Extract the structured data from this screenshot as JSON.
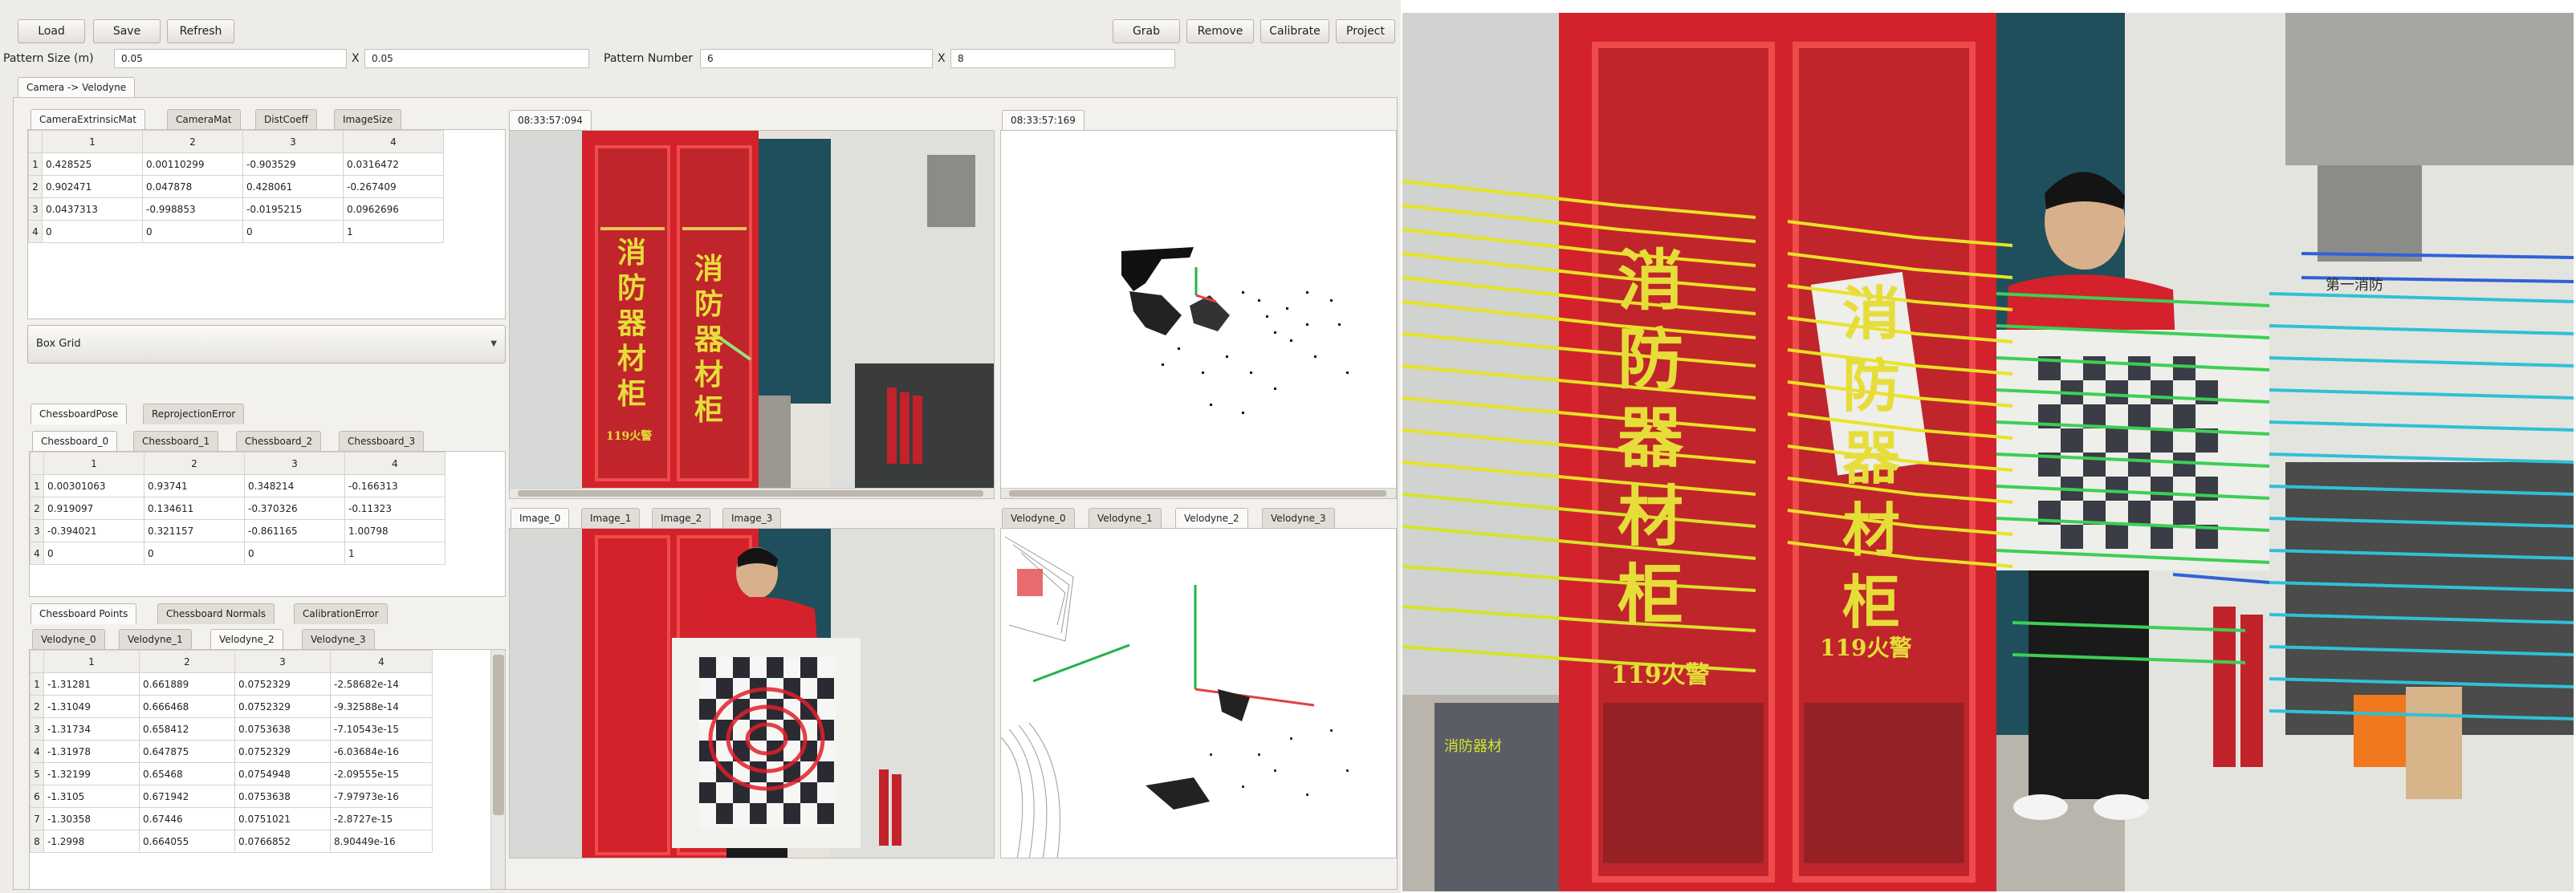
{
  "toolbar": {
    "load": "Load",
    "save": "Save",
    "refresh": "Refresh",
    "grab": "Grab",
    "remove": "Remove",
    "calibrate": "Calibrate",
    "project": "Project"
  },
  "params": {
    "pattern_size_label": "Pattern Size (m)",
    "pattern_size_x": "0.05",
    "x_sep1": "X",
    "pattern_size_y": "0.05",
    "pattern_number_label": "Pattern Number",
    "pattern_number_x": "6",
    "x_sep2": "X",
    "pattern_number_y": "8"
  },
  "main_tab": "Camera -> Velodyne",
  "extrinsic": {
    "tabs": [
      "CameraExtrinsicMat",
      "CameraMat",
      "DistCoeff",
      "ImageSize"
    ],
    "columns": [
      "1",
      "2",
      "3",
      "4"
    ],
    "rows": [
      [
        "1",
        "0.428525",
        "0.00110299",
        "-0.903529",
        "0.0316472"
      ],
      [
        "2",
        "0.902471",
        "0.047878",
        "0.428061",
        "-0.267409"
      ],
      [
        "3",
        "0.0437313",
        "-0.998853",
        "-0.0195215",
        "0.0962696"
      ],
      [
        "4",
        "0",
        "0",
        "0",
        "1"
      ]
    ]
  },
  "pattern_combo": "Box Grid",
  "pose": {
    "tabs": [
      "ChessboardPose",
      "ReprojectionError"
    ],
    "subtabs": [
      "Chessboard_0",
      "Chessboard_1",
      "Chessboard_2",
      "Chessboard_3"
    ],
    "columns": [
      "1",
      "2",
      "3",
      "4"
    ],
    "rows": [
      [
        "1",
        "0.00301063",
        "0.93741",
        "0.348214",
        "-0.166313"
      ],
      [
        "2",
        "0.919097",
        "0.134611",
        "-0.370326",
        "-0.11323"
      ],
      [
        "3",
        "-0.394021",
        "0.321157",
        "-0.861165",
        "1.00798"
      ],
      [
        "4",
        "0",
        "0",
        "0",
        "1"
      ]
    ]
  },
  "points": {
    "tabs": [
      "Chessboard Points",
      "Chessboard Normals",
      "CalibrationError"
    ],
    "subtabs": [
      "Velodyne_0",
      "Velodyne_1",
      "Velodyne_2",
      "Velodyne_3"
    ],
    "columns": [
      "1",
      "2",
      "3",
      "4"
    ],
    "rows": [
      [
        "1",
        "-1.31281",
        "0.661889",
        "0.0752329",
        "-2.58682e-14"
      ],
      [
        "2",
        "-1.31049",
        "0.666468",
        "0.0752329",
        "-9.32588e-14"
      ],
      [
        "3",
        "-1.31734",
        "0.658412",
        "0.0753638",
        "-7.10543e-15"
      ],
      [
        "4",
        "-1.31978",
        "0.647875",
        "0.0752329",
        "-6.03684e-16"
      ],
      [
        "5",
        "-1.32199",
        "0.65468",
        "0.0754948",
        "-2.09555e-15"
      ],
      [
        "6",
        "-1.3105",
        "0.671942",
        "0.0753638",
        "-7.97973e-16"
      ],
      [
        "7",
        "-1.30358",
        "0.67446",
        "0.0751021",
        "-2.8727e-15"
      ],
      [
        "8",
        "-1.2998",
        "0.664055",
        "0.0766852",
        "8.90449e-16"
      ]
    ]
  },
  "camera_view": {
    "tab": "08:33:57:094",
    "sign_chars": [
      "消",
      "防",
      "器",
      "材",
      "柜"
    ],
    "sign_sub": "119火警"
  },
  "lidar_view": {
    "tab": "08:33:57:169"
  },
  "image_tabs": [
    "Image_0",
    "Image_1",
    "Image_2",
    "Image_3"
  ],
  "velodyne_tabs": [
    "Velodyne_0",
    "Velodyne_1",
    "Velodyne_2",
    "Velodyne_3"
  ],
  "projection": {
    "sign_chars": [
      "消",
      "防",
      "器",
      "材",
      "柜"
    ],
    "sign_sub": "119火警",
    "wall_sign": "第一消防",
    "cart_text": "消防器材"
  },
  "colors": {
    "cabinet_red": "#d3222b",
    "lidar_yellow": "#e8e227",
    "lidar_green": "#3ccf55",
    "lidar_cyan": "#2fc0d8",
    "lidar_blue": "#2f62d8"
  }
}
